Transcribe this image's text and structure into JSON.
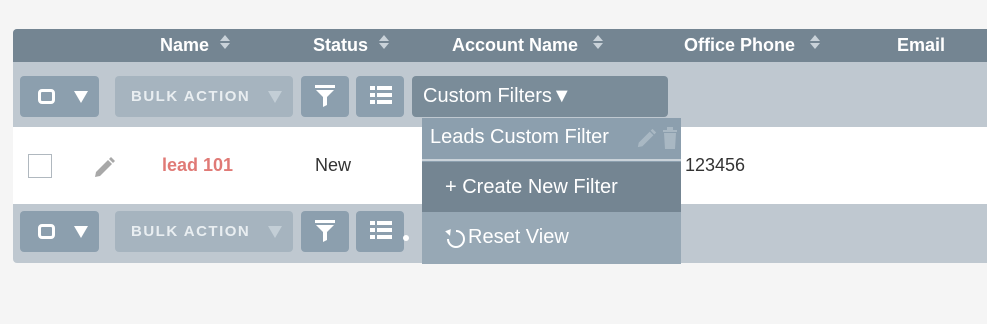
{
  "columns": [
    {
      "label": "Name",
      "sortable": true
    },
    {
      "label": "Status",
      "sortable": true
    },
    {
      "label": "Account Name",
      "sortable": true
    },
    {
      "label": "Office Phone",
      "sortable": true
    },
    {
      "label": "Email",
      "sortable": false
    }
  ],
  "toolbar": {
    "bulk_action_label": "BULK ACTION",
    "custom_filters_label": "Custom Filters▼"
  },
  "row": {
    "name": "lead 101",
    "status": "New",
    "office_phone": "123456"
  },
  "filter_menu": {
    "saved_filter": "Leads Custom Filter",
    "create_label": "+ Create New Filter",
    "reset_label": "Reset View"
  },
  "colors": {
    "header_bg": "#748592",
    "toolbar_bg": "#bfc8d0",
    "button_bg": "#8c9fae",
    "lead_link": "#e07a76"
  },
  "icons": [
    "sort-icon",
    "chevron-down-icon",
    "filter-icon",
    "columns-icon",
    "pencil-icon",
    "trash-icon",
    "reset-icon"
  ]
}
